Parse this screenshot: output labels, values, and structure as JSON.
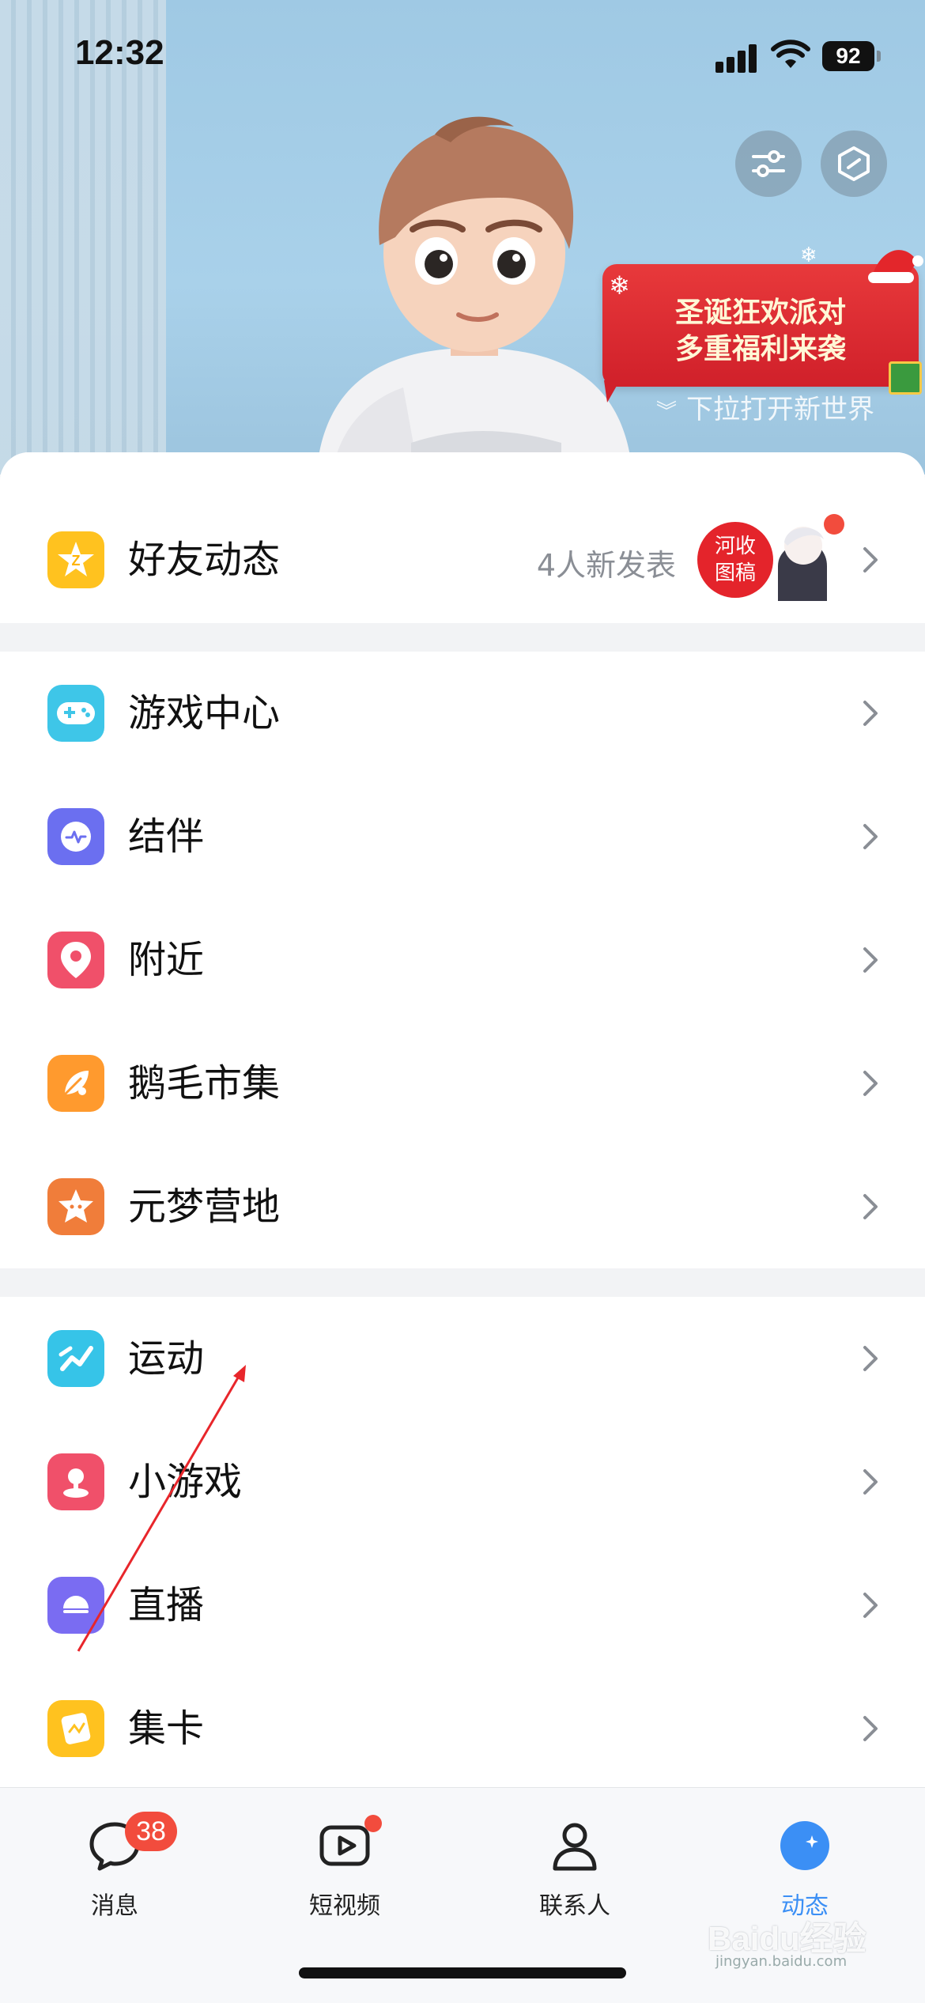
{
  "status_bar": {
    "time": "12:32",
    "battery": "92"
  },
  "hero": {
    "promo_line1": "圣诞狂欢派对",
    "promo_line2": "多重福利来袭",
    "pull_hint": "下拉打开新世界"
  },
  "friend_feed": {
    "label": "好友动态",
    "meta": "4人新发表",
    "thumb_text_1": "河收",
    "thumb_text_2": "图稿"
  },
  "group1": [
    {
      "label": "游戏中心",
      "icon": "gamepad-icon",
      "color": "#3ec6e8"
    },
    {
      "label": "结伴",
      "icon": "heartbeat-bubble-icon",
      "color": "#6b6ff0"
    },
    {
      "label": "附近",
      "icon": "location-pin-icon",
      "color": "#f0506a"
    },
    {
      "label": "鹅毛市集",
      "icon": "feather-tag-icon",
      "color": "#ff9a2e"
    },
    {
      "label": "元梦营地",
      "icon": "star-face-icon",
      "color": "#f07d3a"
    }
  ],
  "group2": [
    {
      "label": "运动",
      "icon": "running-icon",
      "color": "#36c4e8"
    },
    {
      "label": "小游戏",
      "icon": "joystick-icon",
      "color": "#f0506a"
    },
    {
      "label": "直播",
      "icon": "live-icon",
      "color": "#7a6cf2"
    },
    {
      "label": "集卡",
      "icon": "card-icon",
      "color": "#ffc21f"
    }
  ],
  "tabbar": {
    "messages": {
      "label": "消息",
      "badge": "38"
    },
    "short_video": {
      "label": "短视频"
    },
    "contacts": {
      "label": "联系人"
    },
    "feed": {
      "label": "动态"
    }
  },
  "watermark": {
    "text": "Baidu经验",
    "sub": "jingyan.baidu.com"
  },
  "colors": {
    "accent": "#3b8ff5",
    "badge": "#f24c3d"
  }
}
